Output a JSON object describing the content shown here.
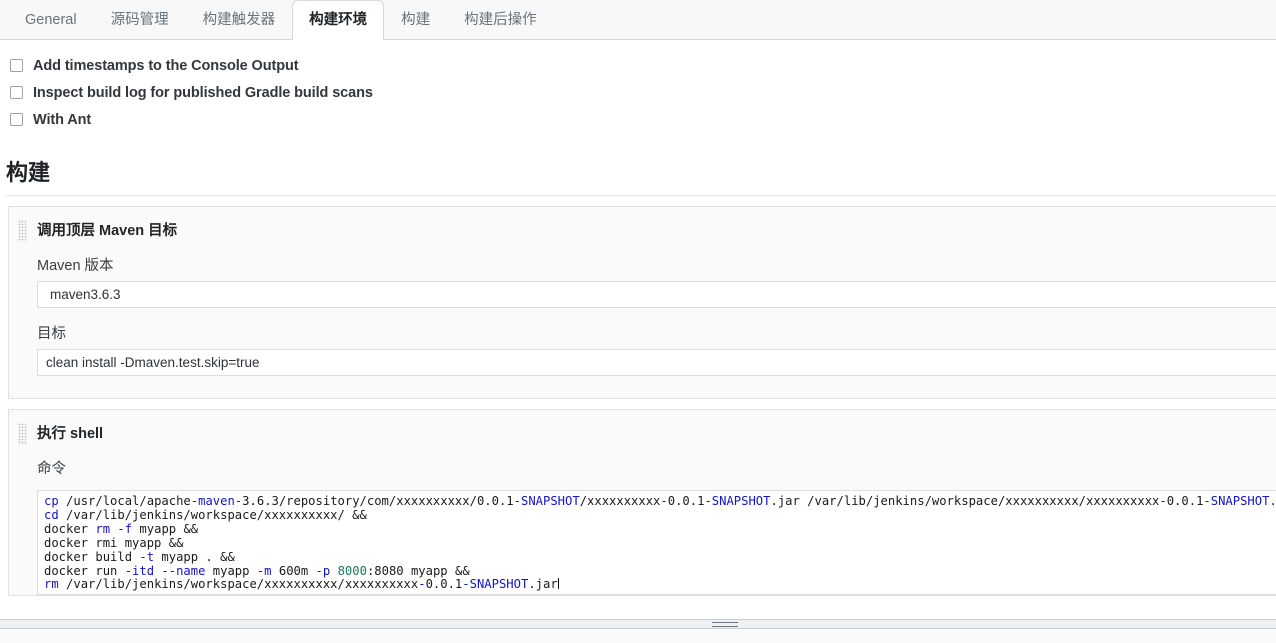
{
  "tabs": [
    {
      "label": "General",
      "active": false
    },
    {
      "label": "源码管理",
      "active": false
    },
    {
      "label": "构建触发器",
      "active": false
    },
    {
      "label": "构建环境",
      "active": true
    },
    {
      "label": "构建",
      "active": false
    },
    {
      "label": "构建后操作",
      "active": false
    }
  ],
  "build_environment": {
    "checkboxes": [
      {
        "label": "Add timestamps to the Console Output",
        "checked": false
      },
      {
        "label": "Inspect build log for published Gradle build scans",
        "checked": false
      },
      {
        "label": "With Ant",
        "checked": false
      }
    ]
  },
  "build_section": {
    "heading": "构建",
    "steps": [
      {
        "title": "调用顶层 Maven 目标",
        "grip_icon": "drag-grip-icon",
        "fields": [
          {
            "label": "Maven 版本",
            "value": "maven3.6.3",
            "placeholder": ""
          },
          {
            "label": "目标",
            "value": "clean install -Dmaven.test.skip=true",
            "placeholder": ""
          }
        ]
      },
      {
        "title": "执行 shell",
        "grip_icon": "drag-grip-icon",
        "command_label": "命令",
        "command_lines": [
          [
            {
              "t": "cp",
              "c": "kw"
            },
            {
              "t": " /usr/local/apache",
              "c": ""
            },
            {
              "t": "-maven-",
              "c": "flg"
            },
            {
              "t": "3.6.3/repository/com/xxxxxxxxxx/0.0.1",
              "c": ""
            },
            {
              "t": "-SNAPSHOT",
              "c": "snap"
            },
            {
              "t": "/xxxxxxxxxx",
              "c": ""
            },
            {
              "t": "-",
              "c": "snap"
            },
            {
              "t": "0.0.1",
              "c": ""
            },
            {
              "t": "-SNAPSHOT",
              "c": "snap"
            },
            {
              "t": ".jar /var/lib/jenkins/workspace/xxxxxxxxxx/xxxxxxxxxx",
              "c": ""
            },
            {
              "t": "-",
              "c": "snap"
            },
            {
              "t": "0.0.1",
              "c": ""
            },
            {
              "t": "-SNAPSHOT",
              "c": "snap"
            },
            {
              "t": ".jar &&",
              "c": ""
            }
          ],
          [
            {
              "t": "cd",
              "c": "kw"
            },
            {
              "t": " /var/lib/jenkins/workspace/xxxxxxxxxx/ &&",
              "c": ""
            }
          ],
          [
            {
              "t": "docker ",
              "c": ""
            },
            {
              "t": "rm",
              "c": "kw"
            },
            {
              "t": " ",
              "c": ""
            },
            {
              "t": "-f",
              "c": "flg"
            },
            {
              "t": " myapp &&",
              "c": ""
            }
          ],
          [
            {
              "t": "docker rmi myapp &&",
              "c": ""
            }
          ],
          [
            {
              "t": "docker build ",
              "c": ""
            },
            {
              "t": "-t",
              "c": "flg"
            },
            {
              "t": " myapp . &&",
              "c": ""
            }
          ],
          [
            {
              "t": "docker run ",
              "c": ""
            },
            {
              "t": "-itd",
              "c": "flg"
            },
            {
              "t": " ",
              "c": ""
            },
            {
              "t": "--name",
              "c": "flg"
            },
            {
              "t": " myapp ",
              "c": ""
            },
            {
              "t": "-m",
              "c": "flg"
            },
            {
              "t": " 600m ",
              "c": ""
            },
            {
              "t": "-p",
              "c": "flg"
            },
            {
              "t": " ",
              "c": ""
            },
            {
              "t": "8000",
              "c": "num"
            },
            {
              "t": ":8080 myapp &&",
              "c": ""
            }
          ],
          [
            {
              "t": "rm",
              "c": "kw"
            },
            {
              "t": " /var/lib/jenkins/workspace/xxxxxxxxxx/xxxxxxxxxx",
              "c": ""
            },
            {
              "t": "-",
              "c": "snap"
            },
            {
              "t": "0.0.1",
              "c": ""
            },
            {
              "t": "-SNAPSHOT",
              "c": "snap"
            },
            {
              "t": ".jar",
              "c": ""
            },
            {
              "t": "|CURSOR|",
              "c": "cursor"
            }
          ]
        ]
      }
    ]
  },
  "resize_handle": {
    "icon": "resize-grip-icon"
  },
  "colors": {
    "active_tab_bg": "#ffffff",
    "tabbar_bg": "#f8f8f8",
    "panel_bg": "#fafafa",
    "border": "#dfe1e3",
    "keyword_blue": "#1414c8",
    "port_green": "#1b7a5a",
    "text": "#333333"
  }
}
